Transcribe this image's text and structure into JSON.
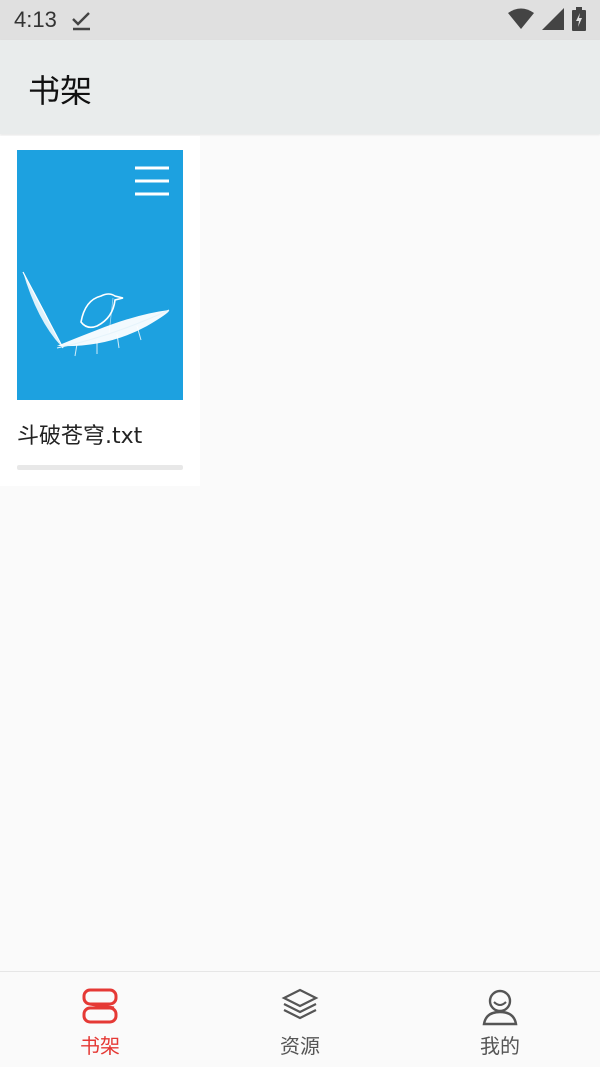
{
  "status_bar": {
    "time": "4:13",
    "colors": {
      "background": "#e0e0e0"
    }
  },
  "app_bar": {
    "title": "书架"
  },
  "bookshelf": {
    "books": [
      {
        "title": "斗破苍穹.txt",
        "cover_color": "#1da1e0"
      }
    ]
  },
  "bottom_nav": {
    "active_color": "#e53935",
    "inactive_color": "#555555",
    "items": [
      {
        "label": "书架",
        "icon": "bookshelf-icon",
        "active": true
      },
      {
        "label": "资源",
        "icon": "layers-icon",
        "active": false
      },
      {
        "label": "我的",
        "icon": "person-icon",
        "active": false
      }
    ]
  }
}
